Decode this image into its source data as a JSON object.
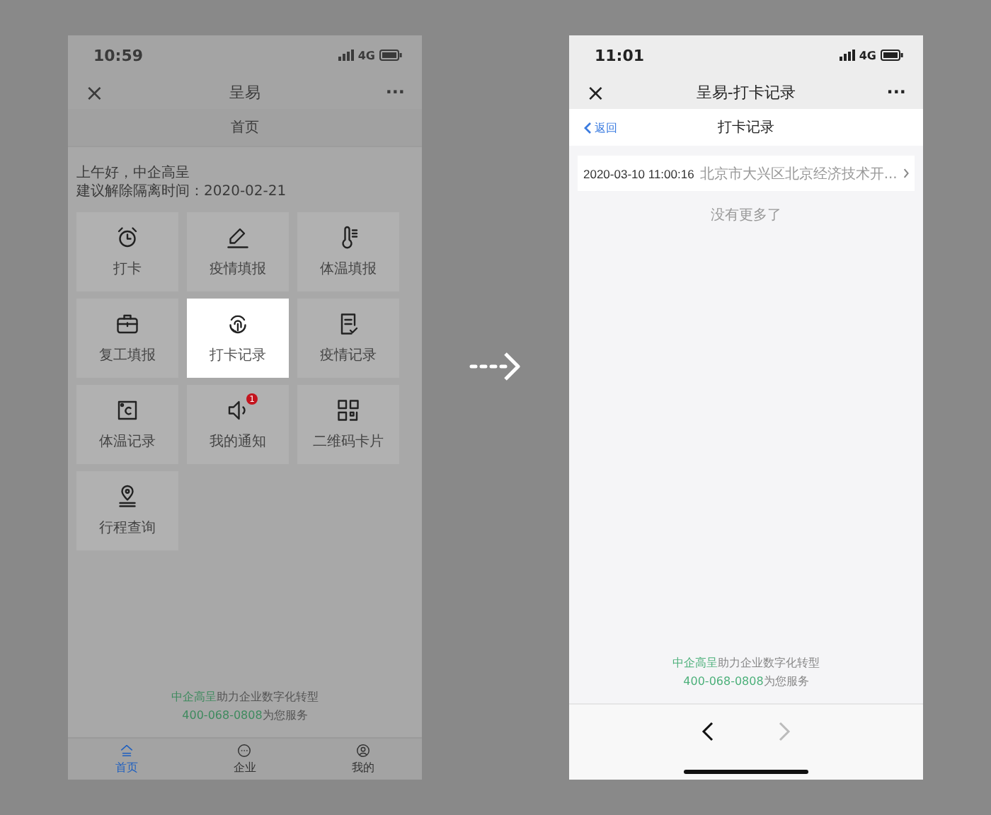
{
  "left_phone": {
    "status_bar": {
      "time": "10:59",
      "network": "4G"
    },
    "nav_bar": {
      "close": "×",
      "title": "呈易",
      "more": "···"
    },
    "page_title": "首页",
    "greeting": {
      "line_1": "上午好，中企高呈",
      "line_2": "建议解除隔离时间：2020-02-21"
    },
    "tiles": [
      {
        "kind": "alarm",
        "label": "打卡",
        "selected": false
      },
      {
        "kind": "pen",
        "label": "疫情填报",
        "selected": false
      },
      {
        "kind": "thermometer",
        "label": "体温填报",
        "selected": false
      },
      {
        "kind": "briefcase",
        "label": "复工填报",
        "selected": false
      },
      {
        "kind": "fingerprint",
        "label": "打卡记录",
        "selected": true
      },
      {
        "kind": "checklist",
        "label": "疫情记录",
        "selected": false
      },
      {
        "kind": "celsius",
        "label": "体温记录",
        "selected": false
      },
      {
        "kind": "speaker",
        "label": "我的通知",
        "selected": false,
        "badge": "1"
      },
      {
        "kind": "qrcode",
        "label": "二维码卡片",
        "selected": false
      },
      {
        "kind": "location",
        "label": "行程查询",
        "selected": false
      }
    ],
    "footer": {
      "line_1": {
        "highlight": "中企高呈",
        "rest": "助力企业数字化转型"
      },
      "line_2": {
        "highlight": "400-068-0808",
        "rest": "为您服务"
      }
    },
    "tab_bar": [
      {
        "kind": "home",
        "label": "首页",
        "selected": true
      },
      {
        "kind": "chat",
        "label": "企业",
        "selected": false
      },
      {
        "kind": "user",
        "label": "我的",
        "selected": false
      }
    ]
  },
  "right_phone": {
    "status_bar": {
      "time": "11:01",
      "network": "4G"
    },
    "nav_bar": {
      "close": "×",
      "title": "呈易-打卡记录",
      "more": "···"
    },
    "header": {
      "back": "返回",
      "title": "打卡记录"
    },
    "records": [
      {
        "time": "2020-03-10 11:00:16",
        "address": "北京市大兴区北京经济技术开..."
      }
    ],
    "end_note": "没有更多了",
    "footer": {
      "line_1": {
        "highlight": "中企高呈",
        "rest": "助力企业数字化转型"
      },
      "line_2": {
        "highlight": "400-068-0808",
        "rest": "为您服务"
      }
    },
    "toolbar": [
      {
        "kind": "back",
        "disabled": false
      },
      {
        "kind": "forward",
        "disabled": true
      }
    ]
  }
}
